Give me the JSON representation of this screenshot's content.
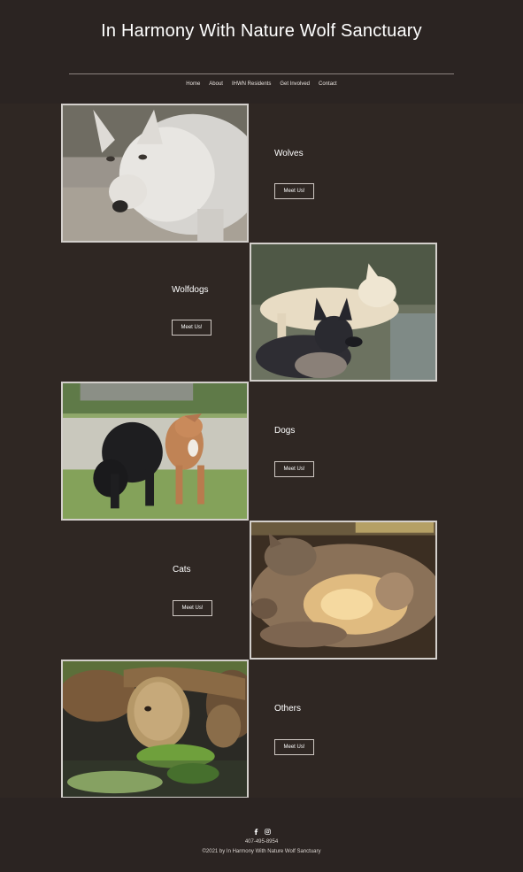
{
  "site": {
    "title": "In Harmony With Nature Wolf Sanctuary"
  },
  "nav": {
    "items": [
      "Home",
      "About",
      "IHWN Residents",
      "Get Involved",
      "Contact"
    ]
  },
  "sections": [
    {
      "title": "Wolves",
      "button": "Meet Us!",
      "image": "white-wolf-photo"
    },
    {
      "title": "Wolfdogs",
      "button": "Meet Us!",
      "image": "wolfdogs-photo"
    },
    {
      "title": "Dogs",
      "button": "Meet Us!",
      "image": "dogs-photo"
    },
    {
      "title": "Cats",
      "button": "Meet Us!",
      "image": "cat-photo"
    },
    {
      "title": "Others",
      "button": "Meet Us!",
      "image": "tortoise-photo"
    }
  ],
  "footer": {
    "social_icons": [
      "facebook-icon",
      "instagram-icon"
    ],
    "phone": "407-495-8954",
    "copyright": "©2021 by In Harmony With Nature Wolf Sanctuary"
  },
  "colors": {
    "header_bg": "#2b2422",
    "main_bg": "#2f2723",
    "photo_border": "#d3cfcb",
    "text": "#ffffff"
  }
}
